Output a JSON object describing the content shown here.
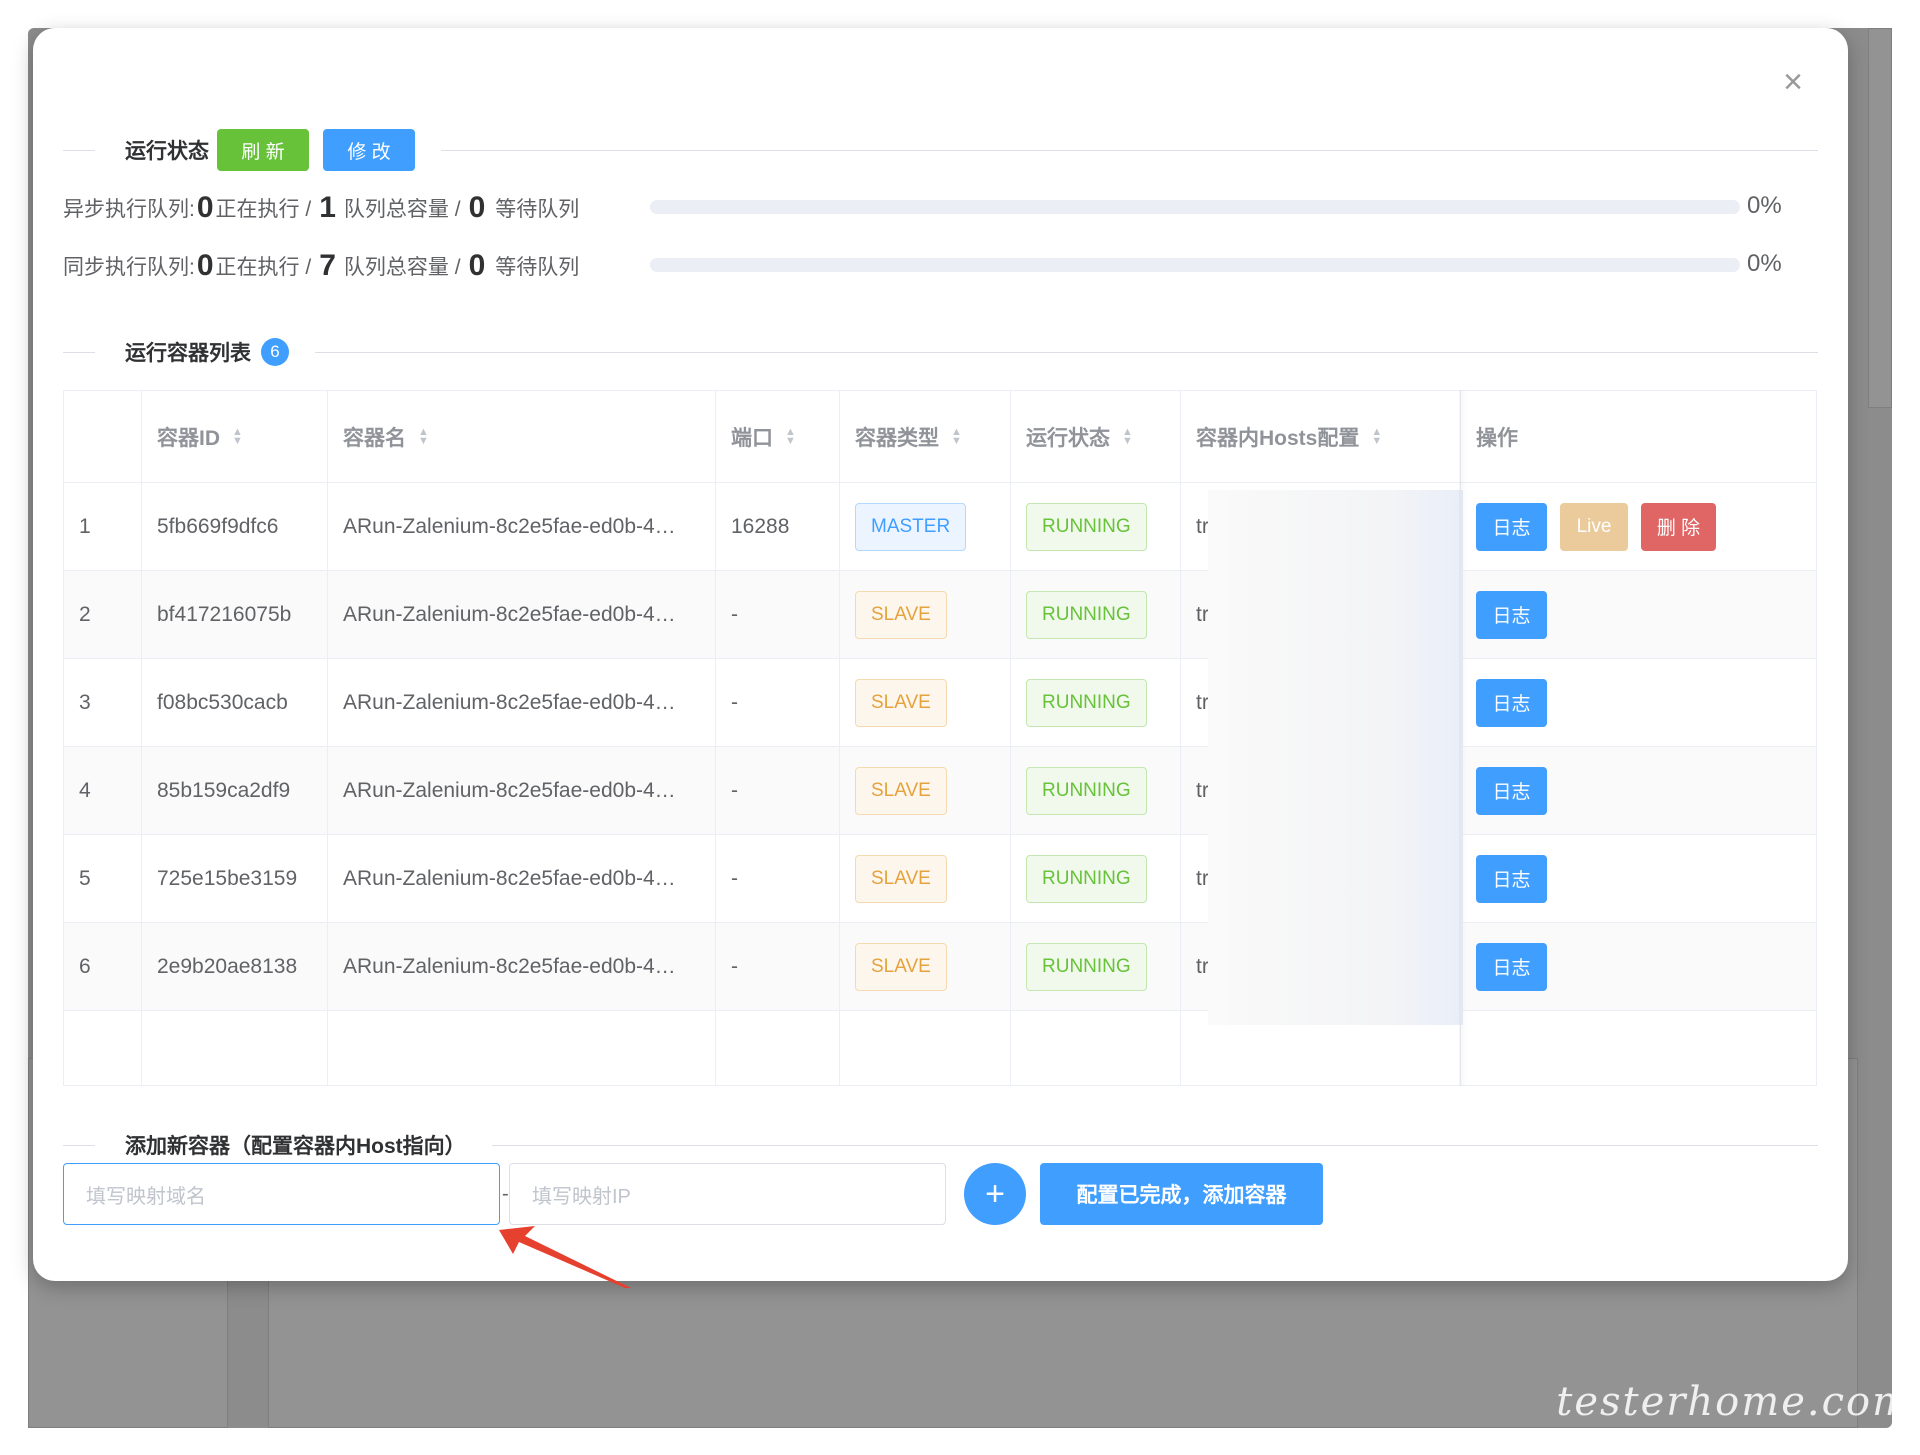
{
  "modal": {
    "close_icon": "close-icon",
    "status_section": {
      "title": "运行状态",
      "refresh_label": "刷 新",
      "edit_label": "修 改"
    },
    "queues": [
      {
        "label": "异步执行队列:",
        "running": "0",
        "running_label": "正在执行 /",
        "capacity": "1",
        "capacity_label": "队列总容量 /",
        "waiting": "0",
        "waiting_label": "等待队列",
        "percent": "0%",
        "progress_value": 0
      },
      {
        "label": "同步执行队列:",
        "running": "0",
        "running_label": "正在执行 /",
        "capacity": "7",
        "capacity_label": "队列总容量 /",
        "waiting": "0",
        "waiting_label": "等待队列",
        "percent": "0%",
        "progress_value": 0
      }
    ],
    "container_section": {
      "title": "运行容器列表",
      "count": "6"
    },
    "table": {
      "headers": [
        "容器ID",
        "容器名",
        "端口",
        "容器类型",
        "运行状态",
        "容器内Hosts配置",
        "操作"
      ],
      "rows": [
        {
          "index": "1",
          "id": "5fb669f9dfc6",
          "name": "ARun-Zalenium-8c2e5fae-ed0b-4…",
          "port": "16288",
          "type": "MASTER",
          "status": "RUNNING",
          "hosts": "tr",
          "actions": [
            "日志",
            "Live",
            "删 除"
          ]
        },
        {
          "index": "2",
          "id": "bf417216075b",
          "name": "ARun-Zalenium-8c2e5fae-ed0b-4…",
          "port": "-",
          "type": "SLAVE",
          "status": "RUNNING",
          "hosts": "tr",
          "actions": [
            "日志"
          ]
        },
        {
          "index": "3",
          "id": "f08bc530cacb",
          "name": "ARun-Zalenium-8c2e5fae-ed0b-4…",
          "port": "-",
          "type": "SLAVE",
          "status": "RUNNING",
          "hosts": "tr",
          "actions": [
            "日志"
          ]
        },
        {
          "index": "4",
          "id": "85b159ca2df9",
          "name": "ARun-Zalenium-8c2e5fae-ed0b-4…",
          "port": "-",
          "type": "SLAVE",
          "status": "RUNNING",
          "hosts": "tr",
          "actions": [
            "日志"
          ]
        },
        {
          "index": "5",
          "id": "725e15be3159",
          "name": "ARun-Zalenium-8c2e5fae-ed0b-4…",
          "port": "-",
          "type": "SLAVE",
          "status": "RUNNING",
          "hosts": "tr",
          "actions": [
            "日志"
          ]
        },
        {
          "index": "6",
          "id": "2e9b20ae8138",
          "name": "ARun-Zalenium-8c2e5fae-ed0b-4…",
          "port": "-",
          "type": "SLAVE",
          "status": "RUNNING",
          "hosts": "tr",
          "actions": [
            "日志"
          ]
        }
      ]
    },
    "add_section": {
      "title": "添加新容器（配置容器内Host指向）",
      "domain_placeholder": "填写映射域名",
      "separator": "-",
      "ip_placeholder": "填写映射IP",
      "add_icon": "plus-icon",
      "submit_label": "配置已完成，添加容器"
    }
  },
  "watermark": "testerhome.com",
  "colors": {
    "primary": "#409eff",
    "success": "#67c23a",
    "warning": "#e6a23c",
    "danger": "#e06666",
    "annotation_arrow": "#e6412f"
  }
}
